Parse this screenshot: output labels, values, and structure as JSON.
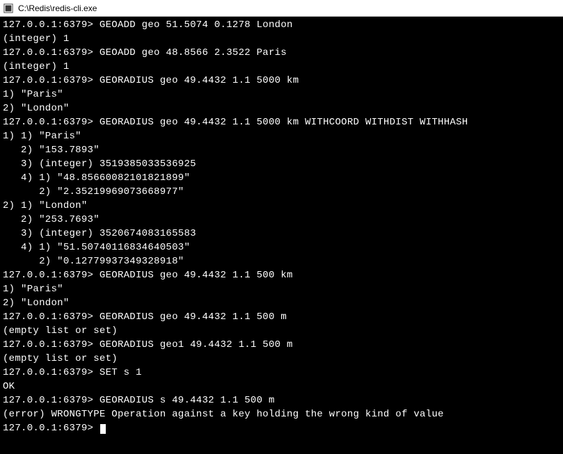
{
  "title_bar": {
    "path": "C:\\Redis\\redis-cli.exe"
  },
  "terminal": {
    "prompt": "127.0.0.1:6379>",
    "lines": [
      "127.0.0.1:6379> GEOADD geo 51.5074 0.1278 London",
      "(integer) 1",
      "127.0.0.1:6379> GEOADD geo 48.8566 2.3522 Paris",
      "(integer) 1",
      "127.0.0.1:6379> GEORADIUS geo 49.4432 1.1 5000 km",
      "1) \"Paris\"",
      "2) \"London\"",
      "127.0.0.1:6379> GEORADIUS geo 49.4432 1.1 5000 km WITHCOORD WITHDIST WITHHASH",
      "1) 1) \"Paris\"",
      "   2) \"153.7893\"",
      "   3) (integer) 3519385033536925",
      "   4) 1) \"48.85660082101821899\"",
      "      2) \"2.35219969073668977\"",
      "2) 1) \"London\"",
      "   2) \"253.7693\"",
      "   3) (integer) 3520674083165583",
      "   4) 1) \"51.50740116834640503\"",
      "      2) \"0.12779937349328918\"",
      "127.0.0.1:6379> GEORADIUS geo 49.4432 1.1 500 km",
      "1) \"Paris\"",
      "2) \"London\"",
      "127.0.0.1:6379> GEORADIUS geo 49.4432 1.1 500 m",
      "(empty list or set)",
      "127.0.0.1:6379> GEORADIUS geo1 49.4432 1.1 500 m",
      "(empty list or set)",
      "127.0.0.1:6379> SET s 1",
      "OK",
      "127.0.0.1:6379> GEORADIUS s 49.4432 1.1 500 m",
      "(error) WRONGTYPE Operation against a key holding the wrong kind of value",
      "127.0.0.1:6379> "
    ]
  }
}
